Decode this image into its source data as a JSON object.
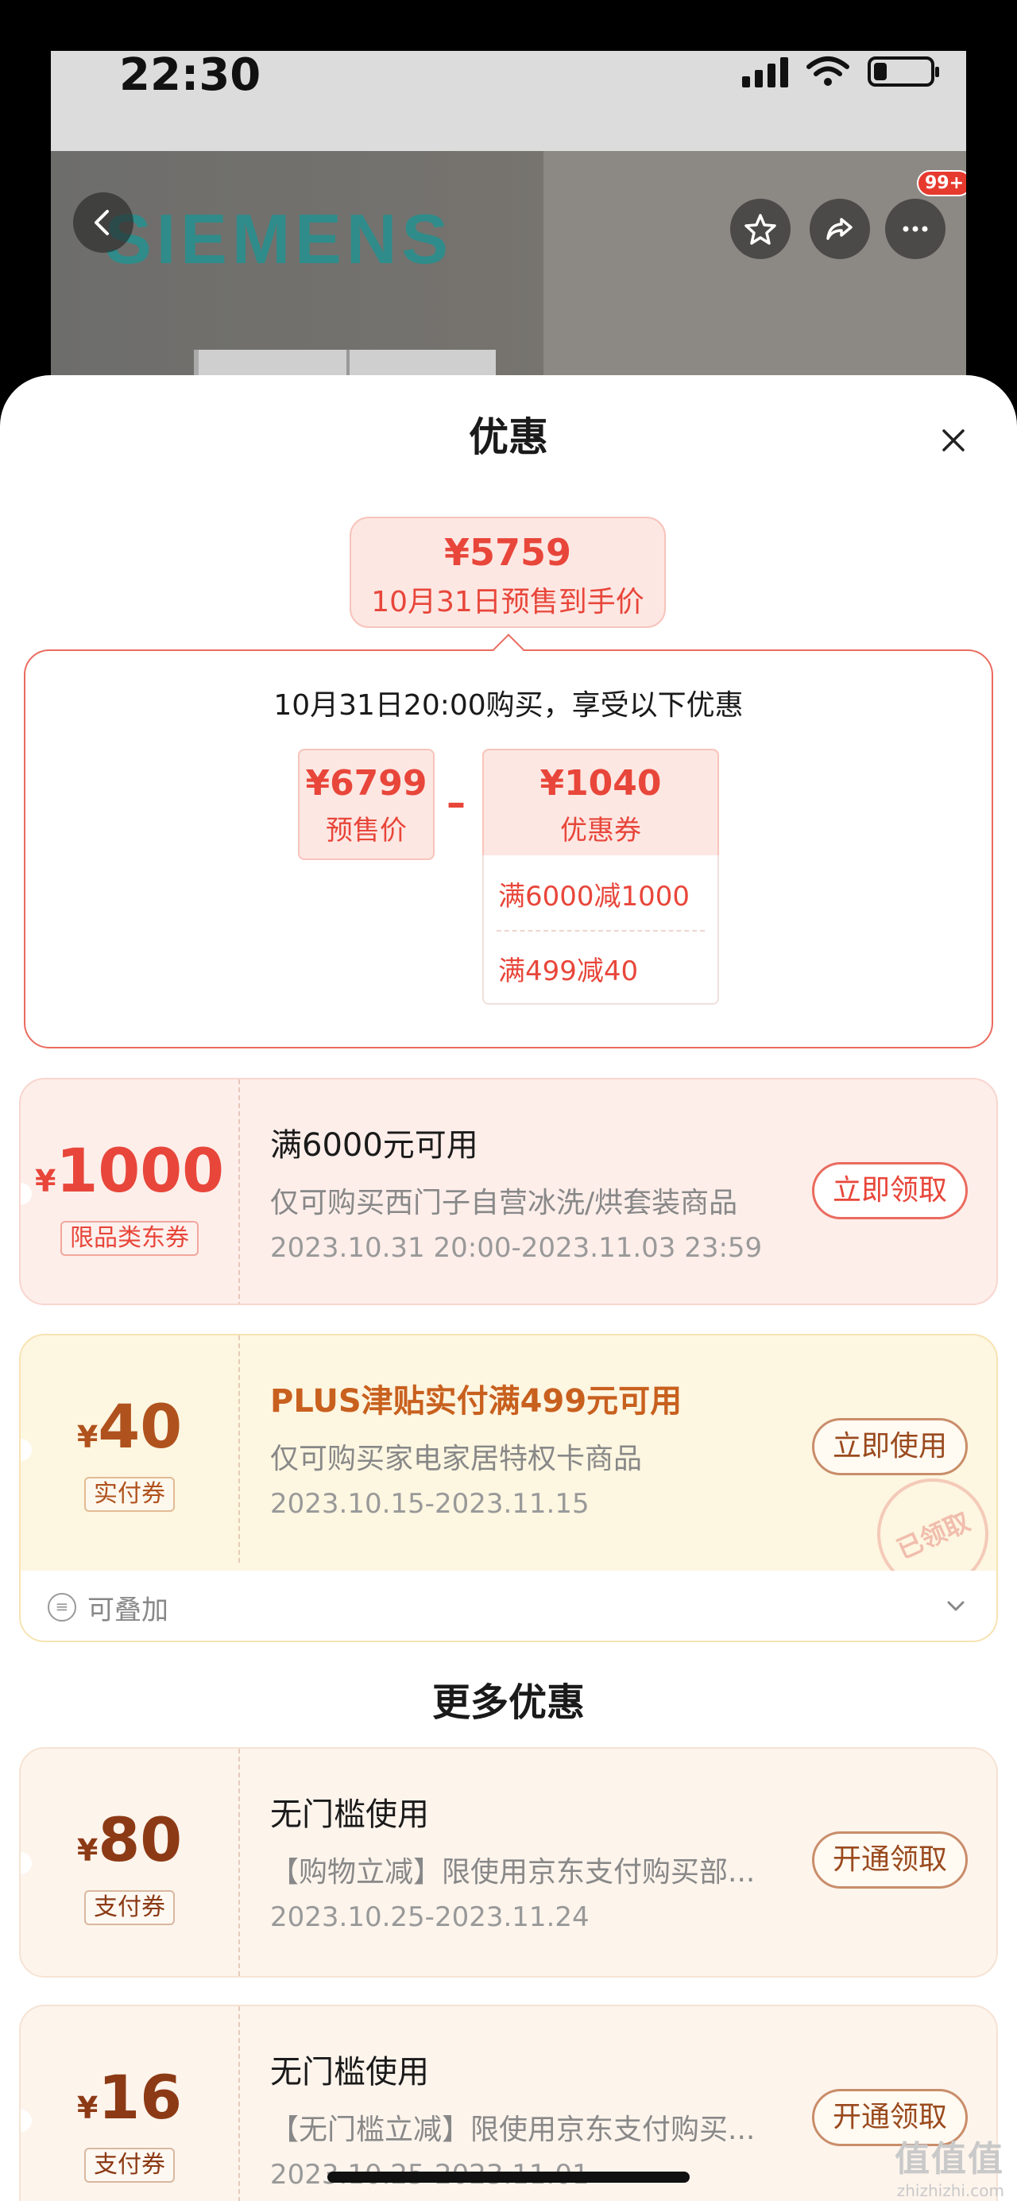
{
  "status_bar": {
    "time": "22:30"
  },
  "background": {
    "brand": "SIEMENS",
    "more_badge": "99+"
  },
  "sheet": {
    "title": "优惠"
  },
  "final_price": {
    "amount": "¥5759",
    "label": "10月31日预售到手价"
  },
  "calculation": {
    "header": "10月31日20:00购买，享受以下优惠",
    "presale": {
      "amount": "¥6799",
      "label": "预售价"
    },
    "operator": "–",
    "coupon": {
      "amount": "¥1040",
      "label": "优惠券"
    },
    "coupon_items": [
      "满6000减1000",
      "满499减40"
    ]
  },
  "coupons": [
    {
      "currency": "¥",
      "value": "1000",
      "tag": "限品类东券",
      "title": "满6000元可用",
      "desc": "仅可购买西门子自营冰洗/烘套装商品",
      "date": "2023.10.31 20:00-2023.11.03 23:59",
      "button": "立即领取",
      "accent": "#e8463a"
    },
    {
      "currency": "¥",
      "value": "40",
      "tag": "实付券",
      "title": "PLUS津贴实付满499元可用",
      "desc": "仅可购买家电家居特权卡商品",
      "date": "2023.10.15-2023.11.15",
      "button": "立即使用",
      "stamp": "已领取",
      "accent": "#b0521d"
    }
  ],
  "stackable": {
    "label": "可叠加"
  },
  "more": {
    "title": "更多优惠",
    "items": [
      {
        "currency": "¥",
        "value": "80",
        "tag": "支付券",
        "title": "无门槛使用",
        "desc": "【购物立减】限使用京东支付购买部...",
        "date": "2023.10.25-2023.11.24",
        "button": "开通领取"
      },
      {
        "currency": "¥",
        "value": "16",
        "tag": "支付券",
        "title": "无门槛使用",
        "desc": "【无门槛立减】限使用京东支付购买...",
        "date": "2023.10.25-2023.11.01",
        "button": "开通领取"
      }
    ]
  },
  "watermark": {
    "line1": "值值值",
    "line2": "zhizhizhi.com"
  }
}
